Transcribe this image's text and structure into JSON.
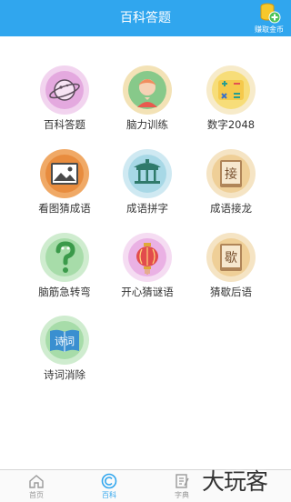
{
  "header": {
    "title": "百科答题",
    "coin_label": "赚取金币"
  },
  "games": [
    {
      "label": "百科答题",
      "icon": "planet-icon",
      "bg": "#f2d4ef"
    },
    {
      "label": "脑力训练",
      "icon": "person-icon",
      "bg": "#f3e2b6"
    },
    {
      "label": "数字2048",
      "icon": "calculator-icon",
      "bg": "#f7ebca"
    },
    {
      "label": "看图猜成语",
      "icon": "picture-icon",
      "bg": "#f0a966"
    },
    {
      "label": "成语拼字",
      "icon": "pavilion-icon",
      "bg": "#cfe9f2"
    },
    {
      "label": "成语接龙",
      "icon": "book-jie-icon",
      "bg": "#f5e4c4"
    },
    {
      "label": "脑筋急转弯",
      "icon": "question-icon",
      "bg": "#cfeccf"
    },
    {
      "label": "开心猜谜语",
      "icon": "lantern-icon",
      "bg": "#f5dcf2"
    },
    {
      "label": "猜歇后语",
      "icon": "book-xie-icon",
      "bg": "#f5e4c4"
    },
    {
      "label": "诗词消除",
      "icon": "poetry-book-icon",
      "bg": "#cfeccf"
    }
  ],
  "inner": {
    "jie": "接",
    "xie": "歇",
    "shici": "诗词"
  },
  "tabs": [
    {
      "label": "首页",
      "icon": "home-icon",
      "active": false
    },
    {
      "label": "百科",
      "icon": "encyclopedia-icon",
      "active": true
    },
    {
      "label": "字典",
      "icon": "dictionary-icon",
      "active": false
    }
  ],
  "watermark": "大玩客",
  "colors": {
    "accent": "#30a6ee"
  }
}
